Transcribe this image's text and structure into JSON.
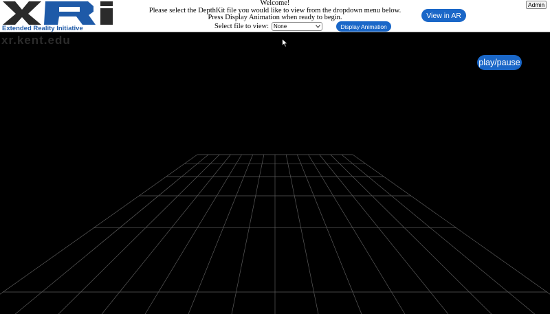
{
  "header": {
    "logo": {
      "brand_text": "XRi",
      "tagline": "Extended Reality Initiative"
    },
    "instructions": {
      "line1": "Welcome!",
      "line2": "Please select the DepthKit file you would like to view from the dropdown menu below.",
      "line3": "Press Display Animation when ready to begin."
    },
    "file_select": {
      "label": "Select file to view:",
      "selected": "None"
    },
    "display_animation_label": "Display Animation",
    "view_ar_label": "View in AR",
    "admin_label": "Admin"
  },
  "viewport": {
    "watermark": "xr.kent.edu",
    "play_pause_label": "play/pause"
  },
  "colors": {
    "accent": "#1a67c8",
    "logo_blue": "#1e5aa8",
    "logo_dark": "#2b2b2b",
    "background": "#000000",
    "grid_line": "#5a5a5a"
  },
  "icons": [
    "chevron-down-icon",
    "cursor-icon"
  ]
}
